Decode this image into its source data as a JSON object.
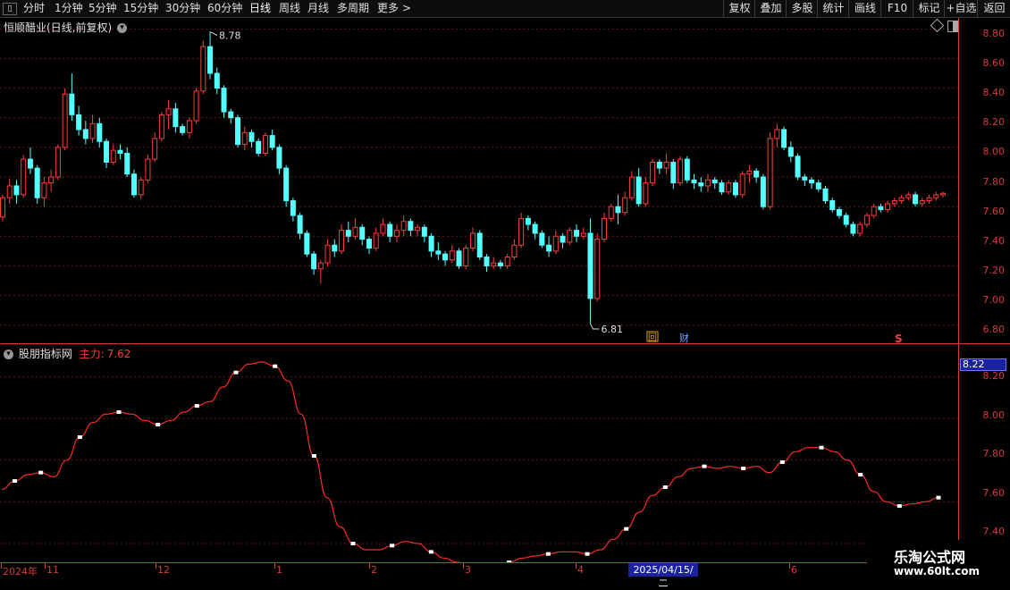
{
  "toolbar": {
    "periods": [
      "分时",
      "1分钟",
      "5分钟",
      "15分钟",
      "30分钟",
      "60分钟",
      "日线",
      "周线",
      "月线",
      "多周期",
      "更多"
    ],
    "more_arrow": ">",
    "actions": [
      "复权",
      "叠加",
      "多股",
      "统计",
      "画线",
      "F10",
      "标记",
      "+自选",
      "返回"
    ]
  },
  "main_panel": {
    "title": "恒顺醋业(日线,前复权)",
    "high_label": "8.78",
    "low_label": "6.81",
    "y_ticks": [
      "8.80",
      "8.60",
      "8.40",
      "8.20",
      "8.00",
      "7.80",
      "7.60",
      "7.40",
      "7.20",
      "7.00",
      "6.80"
    ],
    "markers": {
      "hui": "回",
      "cai": "财",
      "s": "S"
    }
  },
  "indicator_panel": {
    "name": "股朋指标网",
    "series_label": "主力:",
    "series_value": "7.62",
    "current_value": "8.22",
    "y_ticks": [
      "8.20",
      "8.00",
      "7.80",
      "7.60",
      "7.40"
    ]
  },
  "x_axis": {
    "labels": [
      "2024年",
      "11",
      "12",
      "1",
      "2",
      "3",
      "4",
      "6"
    ],
    "highlight": "2025/04/15/二"
  },
  "watermark": {
    "title": "乐淘公式网",
    "url": "www.60lt.com"
  },
  "colors": {
    "up": "#ff3c3c",
    "down": "#54ffff",
    "axis": "#d23c3c",
    "line": "#ff2a2a",
    "highlight_bg": "#1a22a0"
  },
  "chart_data": [
    {
      "type": "candlestick",
      "ylim": [
        6.75,
        8.85
      ],
      "values": [
        [
          7.53,
          7.68,
          7.5,
          7.66
        ],
        [
          7.66,
          7.79,
          7.62,
          7.74
        ],
        [
          7.74,
          7.78,
          7.62,
          7.68
        ],
        [
          7.68,
          7.95,
          7.66,
          7.92
        ],
        [
          7.92,
          8.0,
          7.82,
          7.86
        ],
        [
          7.86,
          7.88,
          7.62,
          7.66
        ],
        [
          7.66,
          7.8,
          7.6,
          7.76
        ],
        [
          7.76,
          7.85,
          7.7,
          7.8
        ],
        [
          7.8,
          8.02,
          7.78,
          8.0
        ],
        [
          8.0,
          8.4,
          7.98,
          8.36
        ],
        [
          8.36,
          8.5,
          8.18,
          8.22
        ],
        [
          8.22,
          8.28,
          8.08,
          8.12
        ],
        [
          8.12,
          8.18,
          8.02,
          8.06
        ],
        [
          8.06,
          8.22,
          8.03,
          8.16
        ],
        [
          8.16,
          8.2,
          8.0,
          8.04
        ],
        [
          8.04,
          8.06,
          7.86,
          7.9
        ],
        [
          7.9,
          8.02,
          7.88,
          7.98
        ],
        [
          7.98,
          8.02,
          7.92,
          7.96
        ],
        [
          7.96,
          8.0,
          7.8,
          7.82
        ],
        [
          7.82,
          7.85,
          7.66,
          7.68
        ],
        [
          7.68,
          7.8,
          7.65,
          7.78
        ],
        [
          7.78,
          7.95,
          7.76,
          7.92
        ],
        [
          7.92,
          8.1,
          7.9,
          8.06
        ],
        [
          8.06,
          8.24,
          8.04,
          8.22
        ],
        [
          8.22,
          8.32,
          8.12,
          8.26
        ],
        [
          8.26,
          8.3,
          8.1,
          8.14
        ],
        [
          8.14,
          8.16,
          8.08,
          8.1
        ],
        [
          8.1,
          8.2,
          8.06,
          8.18
        ],
        [
          8.18,
          8.4,
          8.16,
          8.38
        ],
        [
          8.38,
          8.72,
          8.36,
          8.68
        ],
        [
          8.68,
          8.78,
          8.46,
          8.5
        ],
        [
          8.5,
          8.54,
          8.36,
          8.4
        ],
        [
          8.4,
          8.42,
          8.2,
          8.24
        ],
        [
          8.24,
          8.26,
          8.16,
          8.2
        ],
        [
          8.2,
          8.22,
          8.0,
          8.02
        ],
        [
          8.02,
          8.14,
          7.98,
          8.1
        ],
        [
          8.1,
          8.12,
          8.0,
          8.04
        ],
        [
          8.04,
          8.06,
          7.94,
          7.96
        ],
        [
          7.96,
          8.1,
          7.94,
          8.08
        ],
        [
          8.08,
          8.12,
          7.98,
          8.0
        ],
        [
          8.0,
          8.02,
          7.82,
          7.86
        ],
        [
          7.86,
          7.88,
          7.6,
          7.64
        ],
        [
          7.64,
          7.66,
          7.5,
          7.54
        ],
        [
          7.54,
          7.56,
          7.38,
          7.42
        ],
        [
          7.42,
          7.44,
          7.26,
          7.28
        ],
        [
          7.28,
          7.3,
          7.14,
          7.18
        ],
        [
          7.18,
          7.24,
          7.08,
          7.22
        ],
        [
          7.22,
          7.38,
          7.2,
          7.34
        ],
        [
          7.34,
          7.38,
          7.26,
          7.3
        ],
        [
          7.3,
          7.48,
          7.28,
          7.44
        ],
        [
          7.44,
          7.5,
          7.36,
          7.4
        ],
        [
          7.4,
          7.52,
          7.38,
          7.46
        ],
        [
          7.46,
          7.48,
          7.34,
          7.38
        ],
        [
          7.38,
          7.4,
          7.28,
          7.32
        ],
        [
          7.32,
          7.46,
          7.3,
          7.42
        ],
        [
          7.42,
          7.52,
          7.4,
          7.48
        ],
        [
          7.48,
          7.5,
          7.36,
          7.4
        ],
        [
          7.4,
          7.48,
          7.36,
          7.44
        ],
        [
          7.44,
          7.54,
          7.4,
          7.5
        ],
        [
          7.5,
          7.52,
          7.4,
          7.44
        ],
        [
          7.44,
          7.48,
          7.4,
          7.46
        ],
        [
          7.46,
          7.48,
          7.36,
          7.4
        ],
        [
          7.4,
          7.42,
          7.26,
          7.3
        ],
        [
          7.3,
          7.36,
          7.24,
          7.28
        ],
        [
          7.28,
          7.3,
          7.2,
          7.24
        ],
        [
          7.24,
          7.34,
          7.22,
          7.3
        ],
        [
          7.3,
          7.32,
          7.18,
          7.2
        ],
        [
          7.2,
          7.34,
          7.18,
          7.32
        ],
        [
          7.32,
          7.46,
          7.3,
          7.42
        ],
        [
          7.42,
          7.44,
          7.24,
          7.26
        ],
        [
          7.26,
          7.28,
          7.16,
          7.2
        ],
        [
          7.2,
          7.26,
          7.18,
          7.22
        ],
        [
          7.22,
          7.24,
          7.18,
          7.2
        ],
        [
          7.2,
          7.28,
          7.18,
          7.26
        ],
        [
          7.26,
          7.38,
          7.24,
          7.34
        ],
        [
          7.34,
          7.56,
          7.32,
          7.52
        ],
        [
          7.52,
          7.54,
          7.44,
          7.48
        ],
        [
          7.48,
          7.5,
          7.38,
          7.42
        ],
        [
          7.42,
          7.44,
          7.32,
          7.34
        ],
        [
          7.34,
          7.4,
          7.26,
          7.3
        ],
        [
          7.3,
          7.44,
          7.28,
          7.4
        ],
        [
          7.4,
          7.42,
          7.32,
          7.36
        ],
        [
          7.36,
          7.46,
          7.34,
          7.44
        ],
        [
          7.44,
          7.48,
          7.36,
          7.4
        ],
        [
          7.4,
          7.46,
          7.38,
          7.42
        ],
        [
          7.42,
          7.52,
          6.81,
          6.98
        ],
        [
          6.98,
          7.42,
          6.96,
          7.38
        ],
        [
          7.38,
          7.56,
          7.36,
          7.52
        ],
        [
          7.52,
          7.62,
          7.5,
          7.6
        ],
        [
          7.6,
          7.68,
          7.48,
          7.56
        ],
        [
          7.56,
          7.7,
          7.54,
          7.66
        ],
        [
          7.66,
          7.84,
          7.64,
          7.8
        ],
        [
          7.8,
          7.86,
          7.6,
          7.62
        ],
        [
          7.62,
          7.8,
          7.6,
          7.76
        ],
        [
          7.76,
          7.92,
          7.74,
          7.9
        ],
        [
          7.9,
          7.92,
          7.82,
          7.86
        ],
        [
          7.86,
          7.96,
          7.82,
          7.9
        ],
        [
          7.9,
          7.92,
          7.72,
          7.76
        ],
        [
          7.76,
          7.94,
          7.74,
          7.92
        ],
        [
          7.92,
          7.94,
          7.76,
          7.78
        ],
        [
          7.78,
          7.82,
          7.72,
          7.76
        ],
        [
          7.76,
          7.8,
          7.7,
          7.74
        ],
        [
          7.74,
          7.82,
          7.7,
          7.78
        ],
        [
          7.78,
          7.8,
          7.72,
          7.76
        ],
        [
          7.76,
          7.78,
          7.68,
          7.7
        ],
        [
          7.7,
          7.78,
          7.68,
          7.76
        ],
        [
          7.76,
          7.78,
          7.66,
          7.68
        ],
        [
          7.68,
          7.84,
          7.66,
          7.82
        ],
        [
          7.82,
          7.88,
          7.76,
          7.84
        ],
        [
          7.84,
          7.86,
          7.76,
          7.8
        ],
        [
          7.8,
          7.82,
          7.58,
          7.6
        ],
        [
          7.6,
          8.1,
          7.58,
          8.06
        ],
        [
          8.06,
          8.16,
          8.0,
          8.12
        ],
        [
          8.12,
          8.14,
          7.98,
          8.0
        ],
        [
          8.0,
          8.04,
          7.9,
          7.94
        ],
        [
          7.94,
          7.96,
          7.78,
          7.8
        ],
        [
          7.8,
          7.82,
          7.74,
          7.78
        ],
        [
          7.78,
          7.8,
          7.72,
          7.76
        ],
        [
          7.76,
          7.78,
          7.7,
          7.72
        ],
        [
          7.72,
          7.74,
          7.62,
          7.64
        ],
        [
          7.64,
          7.66,
          7.56,
          7.58
        ],
        [
          7.58,
          7.6,
          7.52,
          7.54
        ],
        [
          7.54,
          7.56,
          7.46,
          7.48
        ],
        [
          7.48,
          7.5,
          7.4,
          7.42
        ],
        [
          7.42,
          7.5,
          7.4,
          7.48
        ],
        [
          7.48,
          7.56,
          7.46,
          7.54
        ],
        [
          7.54,
          7.62,
          7.52,
          7.6
        ],
        [
          7.6,
          7.62,
          7.56,
          7.58
        ],
        [
          7.58,
          7.64,
          7.56,
          7.62
        ],
        [
          7.62,
          7.66,
          7.6,
          7.64
        ],
        [
          7.64,
          7.68,
          7.62,
          7.66
        ],
        [
          7.66,
          7.7,
          7.64,
          7.68
        ],
        [
          7.68,
          7.7,
          7.6,
          7.62
        ],
        [
          7.62,
          7.66,
          7.6,
          7.64
        ],
        [
          7.64,
          7.68,
          7.62,
          7.66
        ],
        [
          7.66,
          7.7,
          7.64,
          7.68
        ],
        [
          7.68,
          7.7,
          7.66,
          7.69
        ]
      ]
    },
    {
      "type": "line",
      "name": "主力",
      "ylim": [
        7.4,
        8.3
      ],
      "values": [
        7.66,
        7.7,
        7.73,
        7.74,
        7.72,
        7.8,
        7.91,
        7.98,
        8.02,
        8.03,
        8.02,
        7.99,
        7.97,
        7.99,
        8.03,
        8.06,
        8.08,
        8.15,
        8.22,
        8.26,
        8.27,
        8.25,
        8.18,
        8.02,
        7.82,
        7.62,
        7.48,
        7.4,
        7.37,
        7.37,
        7.39,
        7.41,
        7.4,
        7.36,
        7.33,
        7.31,
        7.29,
        7.28,
        7.29,
        7.31,
        7.33,
        7.34,
        7.35,
        7.36,
        7.36,
        7.35,
        7.37,
        7.42,
        7.47,
        7.55,
        7.63,
        7.67,
        7.72,
        7.76,
        7.77,
        7.76,
        7.77,
        7.76,
        7.77,
        7.74,
        7.79,
        7.84,
        7.86,
        7.86,
        7.84,
        7.8,
        7.73,
        7.65,
        7.6,
        7.58,
        7.59,
        7.6,
        7.62
      ],
      "markers": [
        {
          "i": 1
        },
        {
          "i": 3
        },
        {
          "i": 6
        },
        {
          "i": 9
        },
        {
          "i": 12
        },
        {
          "i": 15
        },
        {
          "i": 18
        },
        {
          "i": 21
        },
        {
          "i": 24
        },
        {
          "i": 27
        },
        {
          "i": 30
        },
        {
          "i": 33
        },
        {
          "i": 36
        },
        {
          "i": 39
        },
        {
          "i": 42
        },
        {
          "i": 45
        },
        {
          "i": 48
        },
        {
          "i": 51
        },
        {
          "i": 54
        },
        {
          "i": 57
        },
        {
          "i": 60
        },
        {
          "i": 63
        },
        {
          "i": 66
        },
        {
          "i": 69
        },
        {
          "i": 72
        }
      ]
    }
  ]
}
